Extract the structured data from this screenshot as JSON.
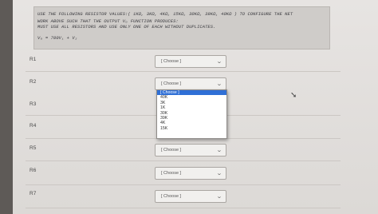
{
  "instructions": {
    "line1": "USE THE FOLLOWING RESISTOR VALUES:( 1KΩ, 3KΩ, 4KΩ, 15KΩ, 30KΩ, 39KΩ, 40KΩ ) TO CONFIGURE THE NET",
    "line2": "WORK ABOVE SUCH THAT THE OUTPUT Vₒ FUNCTION PRODUCES:",
    "line3": "MUST USE ALL RESISTORS AND USE ONLY ONE OF EACH WITHOUT DUPLICATES.",
    "formula": "Vₒ = 700V₁ + V₂"
  },
  "rows": [
    {
      "label": "R1",
      "value": "[ Choose ]"
    },
    {
      "label": "R2",
      "value": "[ Choose ]"
    },
    {
      "label": "R3",
      "value": "[ Choose ]"
    },
    {
      "label": "R4",
      "value": "[ Choose ]"
    },
    {
      "label": "R5",
      "value": "[ Choose ]"
    },
    {
      "label": "R6",
      "value": "[ Choose ]"
    },
    {
      "label": "R7",
      "value": "[ Choose ]"
    }
  ],
  "dropdown": {
    "options": [
      "[ Choose ]",
      "40K",
      "3K",
      "1K",
      "30K",
      "39K",
      "4K",
      "15K"
    ],
    "selected_index": 0
  },
  "icons": {
    "chevron": "chevron-down-icon",
    "cursor": "mouse-pointer-icon"
  }
}
